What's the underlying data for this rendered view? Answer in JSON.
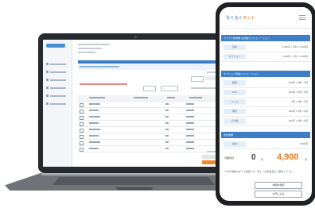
{
  "laptop": {
    "sidebar_items": 6,
    "table_rows": 8
  },
  "phone": {
    "app_title_main": "らくらく",
    "app_title_accent": "ネット",
    "section1_title": "ラクラク請求書 お見積りシミュレーション",
    "section1_rows": [
      {
        "label": "基本",
        "value": "2,000円 × 1件 = 2,000円"
      },
      {
        "label": "オプション",
        "value": "1,000円 × 1件 = 1,000円"
      }
    ],
    "section2_title": "オプション料金シミュレーション",
    "section2_rows": [
      {
        "label": "郵送",
        "value": "200円 × 0件 = 0円"
      },
      {
        "label": "FAX",
        "value": "100円 × 0件 = 0円"
      },
      {
        "label": "メール",
        "value": "0円 × 0件 = 0円"
      },
      {
        "label": "保管",
        "value": "500円 × 0件 = 0円"
      },
      {
        "label": "その他",
        "value": "300円 × 0件 = 0円"
      }
    ],
    "section3_title": "合計金額",
    "section3_rows": [
      {
        "label": "合計",
        "value": "1,900円"
      }
    ],
    "total_label": "月額合計",
    "total_zero": "0",
    "total_yen_small": "円",
    "total_amount": "4,900",
    "total_yen": "円",
    "note": "※表示価格はすべて税抜です。詳しくは料金表をご確認ください。",
    "button1": "詳細を確認",
    "button2": "お申し込み"
  },
  "colors": {
    "accent_blue": "#3d7ec8",
    "accent_orange": "#f07a1a"
  }
}
